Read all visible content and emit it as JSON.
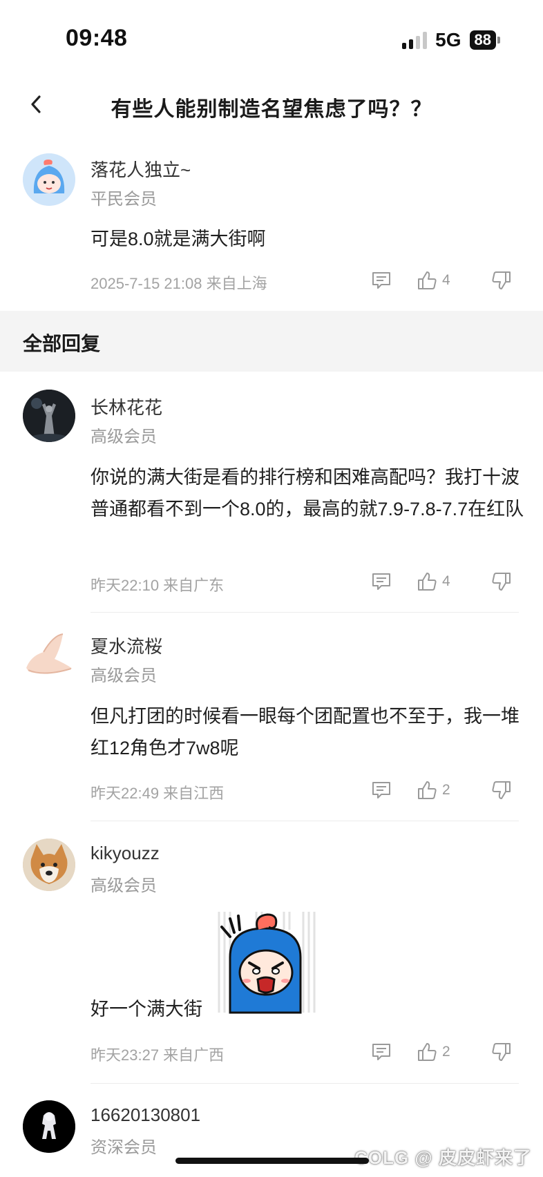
{
  "status_bar": {
    "time": "09:48",
    "network": "5G",
    "battery": "88"
  },
  "nav": {
    "title": "有些人能别制造名望焦虑了吗？？"
  },
  "main_comment": {
    "name": "落花人独立~",
    "level": "平民会员",
    "text": "可是8.0就是满大街啊",
    "meta": "2025-7-15 21:08  来自上海",
    "likes": "4"
  },
  "section": {
    "title": "全部回复"
  },
  "replies": [
    {
      "name": "长林花花",
      "level": "高级会员",
      "text": "你说的满大街是看的排行榜和困难高配吗？我打十波普通都看不到一个8.0的，最高的就7.9-7.8-7.7在红队",
      "meta": "昨天22:10 来自广东",
      "likes": "4"
    },
    {
      "name": "夏水流桜",
      "level": "高级会员",
      "text": "但凡打团的时候看一眼每个团配置也不至于，我一堆红12角色才7w8呢",
      "meta": "昨天22:49 来自江西",
      "likes": "2"
    },
    {
      "name": "kikyouzz",
      "level": "高级会员",
      "text": "好一个满大街",
      "meta": "昨天23:27 来自广西",
      "likes": "2"
    },
    {
      "name": "16620130801",
      "level": "资深会员"
    }
  ],
  "watermark": "COLG @ 皮皮虾来了",
  "icons": [
    "back-arrow-icon",
    "reply-icon",
    "thumbs-up-icon",
    "thumbs-down-icon"
  ],
  "colors": {
    "meta": "#a3a3a3",
    "band": "#f4f4f4",
    "sticker_blue": "#1f7ad6"
  }
}
